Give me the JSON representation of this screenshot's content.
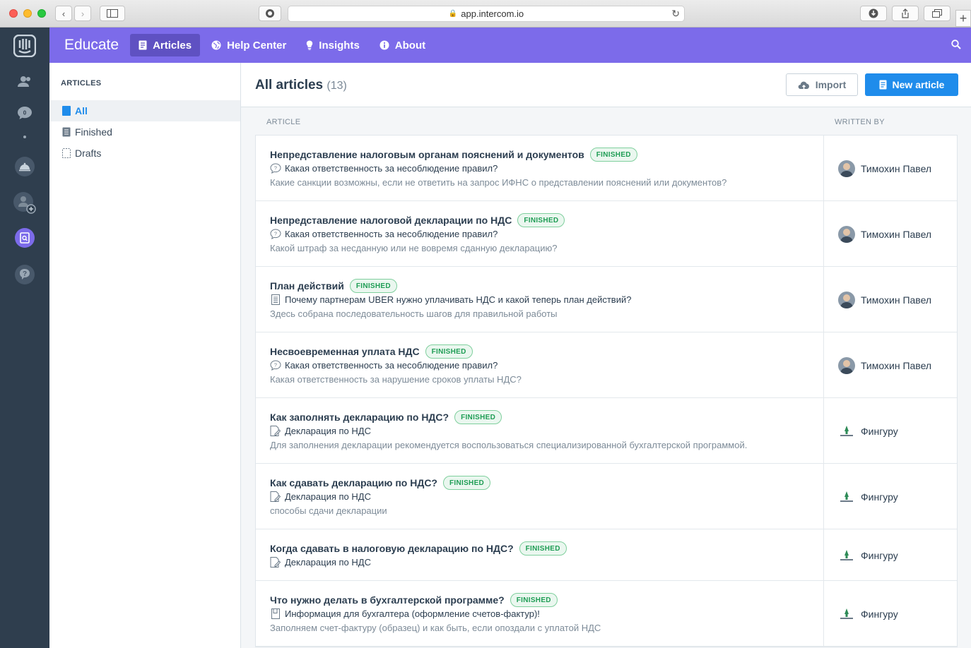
{
  "browser": {
    "url": "app.intercom.io"
  },
  "header": {
    "brand": "Educate",
    "tabs": [
      {
        "label": "Articles",
        "icon": "article-icon"
      },
      {
        "label": "Help Center",
        "icon": "globe-icon"
      },
      {
        "label": "Insights",
        "icon": "lightbulb-icon"
      },
      {
        "label": "About",
        "icon": "info-icon"
      }
    ]
  },
  "subnav": {
    "title": "ARTICLES",
    "items": [
      {
        "label": "All"
      },
      {
        "label": "Finished"
      },
      {
        "label": "Drafts"
      }
    ]
  },
  "main": {
    "title": "All articles",
    "count": "(13)",
    "import_label": "Import",
    "new_label": "New article",
    "col_article": "ARTICLE",
    "col_written_by": "WRITTEN BY"
  },
  "colors": {
    "header": "#7c6bea",
    "primary": "#1f8ceb",
    "finished": "#1f9d55",
    "sidebar": "#2f3e4e"
  },
  "articles": [
    {
      "title": "Непредставление налоговым органам пояснений и документов",
      "status": "FINISHED",
      "collection": "Какая ответственность за несоблюдение правил?",
      "collection_icon": "question-bubble-icon",
      "description": "Какие санкции возможны, если не ответить на запрос ИФНС о представлении пояснений или документов?",
      "author": "Тимохин Павел"
    },
    {
      "title": "Непредставление налоговой декларации по НДС",
      "status": "FINISHED",
      "collection": "Какая ответственность за несоблюдение правил?",
      "collection_icon": "question-bubble-icon",
      "description": "Какой штраф за несданную или не вовремя сданную декларацию?",
      "author": "Тимохин Павел"
    },
    {
      "title": "План действий",
      "status": "FINISHED",
      "collection": "Почему партнерам UBER нужно уплачивать НДС и какой теперь план действий?",
      "collection_icon": "document-icon",
      "description": "Здесь собрана последовательность шагов для правильной работы",
      "author": "Тимохин Павел"
    },
    {
      "title": "Несвоевременная уплата НДС",
      "status": "FINISHED",
      "collection": "Какая ответственность за несоблюдение правил?",
      "collection_icon": "question-bubble-icon",
      "description": "Какая ответственность за нарушение сроков уплаты НДС?",
      "author": "Тимохин Павел"
    },
    {
      "title": "Как заполнять декларацию по НДС?",
      "status": "FINISHED",
      "collection": "Декларация по НДС",
      "collection_icon": "edit-document-icon",
      "description": "Для заполнения декларации рекомендуется воспользоваться специализированной бухгалтерской программой.",
      "author": "Фингуру"
    },
    {
      "title": "Как сдавать декларацию по НДС?",
      "status": "FINISHED",
      "collection": "Декларация по НДС",
      "collection_icon": "edit-document-icon",
      "description": "способы сдачи декларации",
      "author": "Фингуру"
    },
    {
      "title": "Когда сдавать в налоговую декларацию по НДС?",
      "status": "FINISHED",
      "collection": "Декларация по НДС",
      "collection_icon": "edit-document-icon",
      "description": "",
      "author": "Фингуру"
    },
    {
      "title": "Что нужно делать в бухгалтерской программе?",
      "status": "FINISHED",
      "collection": "Информация для бухгалтера (оформление счетов-фактур)!",
      "collection_icon": "book-icon",
      "description": "Заполняем счет-фактуру (образец) и как быть, если опоздали с уплатой НДС",
      "author": "Фингуру"
    }
  ]
}
